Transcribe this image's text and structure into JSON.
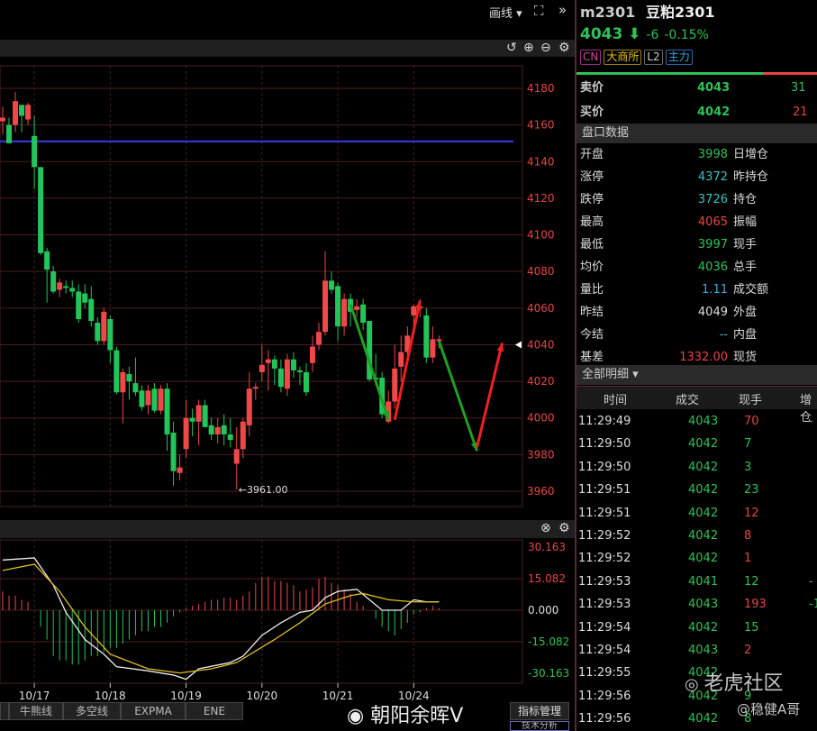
{
  "topbar": {
    "draw_label": "画线 ▾",
    "fullscreen_icon": "fullscreen-icon",
    "collapse_icon": "double-chevron-right-icon"
  },
  "toolbar": {
    "icons": [
      "undo-icon",
      "zoom-in-icon",
      "zoom-out-icon",
      "gear-icon"
    ]
  },
  "quote": {
    "code": "m2301",
    "name": "豆粕2301",
    "price": "4043",
    "change": "-6",
    "change_pct": "-0.15%",
    "badges": [
      "CN",
      "大商所",
      "L2",
      "主力"
    ],
    "ask_label": "卖价",
    "ask": "4043",
    "ask_vol": "31",
    "bid_label": "买价",
    "bid": "4042",
    "bid_vol": "21",
    "buy_ratio": 0.77
  },
  "panel_section": "盘口数据",
  "stats": [
    {
      "label": "开盘",
      "value": "3998",
      "color": "g",
      "label2": "日增仓"
    },
    {
      "label": "涨停",
      "value": "4372",
      "color": "c",
      "label2": "昨持仓"
    },
    {
      "label": "跌停",
      "value": "3726",
      "color": "c",
      "label2": "持仓"
    },
    {
      "label": "最高",
      "value": "4065",
      "color": "r",
      "label2": "振幅"
    },
    {
      "label": "最低",
      "value": "3997",
      "color": "g",
      "label2": "现手"
    },
    {
      "label": "均价",
      "value": "4036",
      "color": "g",
      "label2": "总手"
    },
    {
      "label": "量比",
      "value": "1.11",
      "color": "b",
      "label2": "成交额"
    },
    {
      "label": "昨结",
      "value": "4049",
      "color": "w",
      "label2": "外盘"
    },
    {
      "label": "今结",
      "value": "--",
      "color": "c",
      "label2": "内盘"
    },
    {
      "label": "基差",
      "value": "1332.00",
      "color": "r",
      "label2": "现货"
    }
  ],
  "trades_section": "全部明细 ▾",
  "trade_headers": [
    "时间",
    "成交",
    "现手",
    "增仓"
  ],
  "trades": [
    {
      "t": "11:29:49",
      "p": "4043",
      "v": "70",
      "vc": "r",
      "z": "-"
    },
    {
      "t": "11:29:50",
      "p": "4042",
      "v": "7",
      "vc": "g",
      "z": ""
    },
    {
      "t": "11:29:50",
      "p": "4042",
      "v": "3",
      "vc": "g",
      "z": ""
    },
    {
      "t": "11:29:51",
      "p": "4042",
      "v": "23",
      "vc": "g",
      "z": ""
    },
    {
      "t": "11:29:51",
      "p": "4042",
      "v": "12",
      "vc": "r",
      "z": ""
    },
    {
      "t": "11:29:52",
      "p": "4042",
      "v": "8",
      "vc": "r",
      "z": ""
    },
    {
      "t": "11:29:52",
      "p": "4042",
      "v": "1",
      "vc": "r",
      "z": ""
    },
    {
      "t": "11:29:53",
      "p": "4041",
      "v": "12",
      "vc": "g",
      "z": "-"
    },
    {
      "t": "11:29:53",
      "p": "4043",
      "v": "193",
      "vc": "r",
      "z": "-1"
    },
    {
      "t": "11:29:54",
      "p": "4042",
      "v": "15",
      "vc": "g",
      "z": ""
    },
    {
      "t": "11:29:54",
      "p": "4043",
      "v": "2",
      "vc": "r",
      "z": ""
    },
    {
      "t": "11:29:55",
      "p": "4042",
      "v": "",
      "vc": "g",
      "z": ""
    },
    {
      "t": "11:29:56",
      "p": "4042",
      "v": "9",
      "vc": "g",
      "z": ""
    },
    {
      "t": "11:29:56",
      "p": "4042",
      "v": "8",
      "vc": "g",
      "z": ""
    }
  ],
  "watermarks": {
    "tiger": "老虎社区",
    "author": "@稳健A哥",
    "weibo": "朝阳余晖V"
  },
  "bottom_tabs": [
    "牛熊线",
    "多空线",
    "EXPMA",
    "ENE"
  ],
  "indicator_button": "指标管理",
  "bottom_cut": "技术分析",
  "colors": {
    "up": "#f04848",
    "down": "#22c55a",
    "grid": "#4a1e1e",
    "hline": "#3a3ae8"
  },
  "chart_data": {
    "type": "candlestick",
    "price_ticks": [
      "4180",
      "4160",
      "4140",
      "4120",
      "4100",
      "4080",
      "4060",
      "4040",
      "4020",
      "4000",
      "3980",
      "3960"
    ],
    "ylim": [
      3955,
      4188
    ],
    "date_labels": [
      {
        "label": "10/17",
        "i": 5
      },
      {
        "label": "10/18",
        "i": 17
      },
      {
        "label": "10/19",
        "i": 29
      },
      {
        "label": "10/20",
        "i": 41
      },
      {
        "label": "10/21",
        "i": 53
      },
      {
        "label": "10/24",
        "i": 65
      }
    ],
    "horizontal_line": 4151,
    "low_annotation": {
      "label": "←3961.00",
      "i": 37,
      "price": 3961
    },
    "current_marker": 4040,
    "candles": [
      [
        4162,
        4170,
        4155,
        4164
      ],
      [
        4160,
        4164,
        4150,
        4150
      ],
      [
        4160,
        4178,
        4156,
        4173
      ],
      [
        4171,
        4168,
        4156,
        4165
      ],
      [
        4163,
        4172,
        4160,
        4171
      ],
      [
        4154,
        4165,
        4125,
        4137
      ],
      [
        4137,
        4137,
        4089,
        4090
      ],
      [
        4091,
        4093,
        4063,
        4081
      ],
      [
        4080,
        4083,
        4068,
        4069
      ],
      [
        4070,
        4076,
        4066,
        4074
      ],
      [
        4072,
        4075,
        4068,
        4071
      ],
      [
        4071,
        4075,
        4066,
        4069
      ],
      [
        4069,
        4073,
        4052,
        4054
      ],
      [
        4068,
        4073,
        4060,
        4063
      ],
      [
        4065,
        4072,
        4050,
        4053
      ],
      [
        4052,
        4055,
        4040,
        4042
      ],
      [
        4042,
        4060,
        4040,
        4058
      ],
      [
        4054,
        4056,
        4030,
        4037
      ],
      [
        4037,
        4039,
        4013,
        4014
      ],
      [
        4014,
        4027,
        3997,
        4025
      ],
      [
        4024,
        4028,
        4010,
        4020
      ],
      [
        4019,
        4033,
        4012,
        4014
      ],
      [
        4015,
        4018,
        4004,
        4006
      ],
      [
        4007,
        4018,
        4002,
        4015
      ],
      [
        4016,
        4019,
        4003,
        4004
      ],
      [
        4004,
        4018,
        4002,
        4016
      ],
      [
        4016,
        4019,
        3982,
        3991
      ],
      [
        3992,
        3998,
        3963,
        3971
      ],
      [
        3970,
        3980,
        3966,
        3973
      ],
      [
        3983,
        4010,
        3978,
        4000
      ],
      [
        4000,
        4005,
        3990,
        3998
      ],
      [
        3998,
        4010,
        3985,
        4007
      ],
      [
        4007,
        4010,
        3995,
        3995
      ],
      [
        3996,
        4000,
        3988,
        3991
      ],
      [
        3991,
        4000,
        3986,
        3995
      ],
      [
        3996,
        4002,
        3985,
        3991
      ],
      [
        3991,
        4000,
        3984,
        3988
      ],
      [
        3975,
        3995,
        3961,
        3983
      ],
      [
        3983,
        4000,
        3978,
        3998
      ],
      [
        3996,
        4025,
        3990,
        4016
      ],
      [
        4016,
        4019,
        4010,
        4017
      ],
      [
        4025,
        4040,
        4020,
        4029
      ],
      [
        4030,
        4037,
        4015,
        4032
      ],
      [
        4032,
        4034,
        4018,
        4027
      ],
      [
        4027,
        4032,
        4014,
        4017
      ],
      [
        4016,
        4035,
        4012,
        4032
      ],
      [
        4032,
        4036,
        4022,
        4026
      ],
      [
        4026,
        4028,
        4018,
        4025
      ],
      [
        4025,
        4030,
        4012,
        4014
      ],
      [
        4030,
        4045,
        4025,
        4039
      ],
      [
        4040,
        4052,
        4037,
        4047
      ],
      [
        4047,
        4091,
        4045,
        4075
      ],
      [
        4075,
        4080,
        4068,
        4070
      ],
      [
        4072,
        4074,
        4042,
        4050
      ],
      [
        4050,
        4068,
        4045,
        4065
      ],
      [
        4065,
        4068,
        4050,
        4058
      ],
      [
        4059,
        4065,
        4055,
        4061
      ],
      [
        4062,
        4065,
        4048,
        4052
      ],
      [
        4053,
        4053,
        4020,
        4021
      ],
      [
        4022,
        4035,
        4018,
        4021
      ],
      [
        4022,
        4025,
        4000,
        4002
      ],
      [
        3998,
        4015,
        3997,
        4009
      ],
      [
        4009,
        4040,
        4005,
        4027
      ],
      [
        4028,
        4045,
        4020,
        4036
      ],
      [
        4036,
        4050,
        4030,
        4045
      ],
      [
        4056,
        4062,
        4050,
        4061
      ],
      [
        4060,
        4065,
        4055,
        4061
      ],
      [
        4056,
        4060,
        4030,
        4033
      ],
      [
        4033,
        4050,
        4030,
        4043
      ],
      [
        4042,
        4045,
        4038,
        4043
      ]
    ],
    "arrows": [
      {
        "color": "down",
        "from": [
          55,
          4062
        ],
        "to": [
          61,
          3999
        ]
      },
      {
        "color": "up",
        "from": [
          62,
          3999
        ],
        "to": [
          66,
          4064
        ]
      },
      {
        "color": "down",
        "from": [
          69,
          4042
        ],
        "to": [
          75,
          3982
        ]
      },
      {
        "color": "up",
        "from": [
          75,
          3984
        ],
        "to": [
          79,
          4041
        ]
      }
    ],
    "macd": {
      "ticks": [
        "30.163",
        "15.082",
        "0.000",
        "-15.082",
        "-30.163"
      ],
      "ylim": [
        -30.163,
        30.163
      ],
      "dif": [
        [
          0,
          24
        ],
        [
          5,
          25
        ],
        [
          8,
          12
        ],
        [
          10,
          -1
        ],
        [
          13,
          -14
        ],
        [
          16,
          -21
        ],
        [
          18,
          -27
        ],
        [
          23,
          -29
        ],
        [
          27,
          -31
        ],
        [
          29,
          -33
        ],
        [
          31,
          -28
        ],
        [
          36,
          -25
        ],
        [
          38,
          -22
        ],
        [
          41,
          -12
        ],
        [
          44,
          -6
        ],
        [
          47,
          -1
        ],
        [
          49,
          0
        ],
        [
          51,
          6
        ],
        [
          53,
          9
        ],
        [
          56,
          10
        ],
        [
          58,
          5
        ],
        [
          60,
          0
        ],
        [
          63,
          0
        ],
        [
          65,
          5
        ],
        [
          67,
          4
        ],
        [
          69,
          4
        ]
      ],
      "dea": [
        [
          0,
          19
        ],
        [
          5,
          22
        ],
        [
          9,
          9
        ],
        [
          13,
          -8
        ],
        [
          17,
          -21
        ],
        [
          23,
          -28
        ],
        [
          28,
          -30
        ],
        [
          33,
          -28
        ],
        [
          37,
          -25
        ],
        [
          43,
          -14
        ],
        [
          47,
          -6
        ],
        [
          51,
          3
        ],
        [
          55,
          7
        ],
        [
          57,
          8
        ],
        [
          61,
          5
        ],
        [
          65,
          4
        ],
        [
          69,
          4
        ]
      ],
      "hist": [
        9,
        7,
        7,
        5,
        4,
        0,
        -8,
        -14,
        -22,
        -24,
        -24,
        -26,
        -26,
        -24,
        -22,
        -22,
        -20,
        -18,
        -18,
        -16,
        -14,
        -12,
        -10,
        -10,
        -8,
        -8,
        -6,
        -3,
        -1,
        1,
        2,
        3,
        4,
        5,
        5,
        6,
        6,
        5,
        7,
        9,
        13,
        16,
        16,
        14,
        14,
        13,
        12,
        9,
        10,
        11,
        15,
        16,
        13,
        12,
        10,
        8,
        4,
        2,
        0,
        -4,
        -8,
        -10,
        -12,
        -9,
        -6,
        -2,
        -1,
        1,
        2,
        1
      ]
    }
  }
}
